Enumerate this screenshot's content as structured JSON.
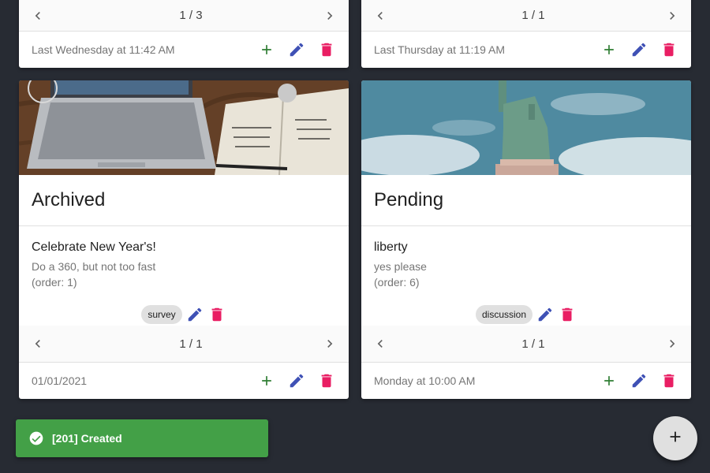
{
  "colors": {
    "background": "#272b33",
    "add": "#2e7d32",
    "edit": "#3f51b5",
    "delete": "#e91e63",
    "snackbar": "#43a047"
  },
  "top_cards": [
    {
      "pager": "1 / 3",
      "timestamp": "Last Wednesday at 11:42 AM"
    },
    {
      "pager": "1 / 1",
      "timestamp": "Last Thursday at 11:19 AM"
    }
  ],
  "cards": [
    {
      "image": "laptop-notebook-photo",
      "title": "Archived",
      "item": {
        "name": "Celebrate New Year's!",
        "description": "Do a 360, but not too fast",
        "order": "(order: 1)",
        "tag": "survey"
      },
      "pager": "1 / 1",
      "timestamp": "01/01/2021"
    },
    {
      "image": "statue-of-liberty-photo",
      "title": "Pending",
      "item": {
        "name": "liberty",
        "description": "yes please",
        "order": "(order: 6)",
        "tag": "discussion"
      },
      "pager": "1 / 1",
      "timestamp": "Monday at 10:00 AM"
    }
  ],
  "snackbar": {
    "message": "[201] Created",
    "icon": "check-circle-icon"
  },
  "fab": {
    "icon": "plus-icon"
  }
}
